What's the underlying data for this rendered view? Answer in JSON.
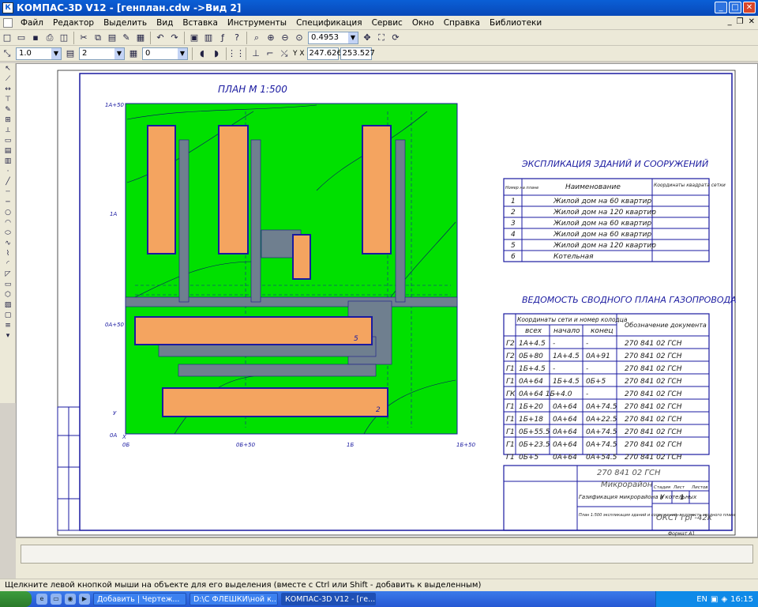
{
  "window": {
    "title": "КОМПАС-3D V12 - [генплан.cdw ->Вид 2]",
    "app_icon": "kompas-icon"
  },
  "menu": [
    "Файл",
    "Редактор",
    "Выделить",
    "Вид",
    "Вставка",
    "Инструменты",
    "Спецификация",
    "Сервис",
    "Окно",
    "Справка",
    "Библиотеки"
  ],
  "toolbar": {
    "zoom": "0.4953"
  },
  "toolbar2": {
    "linetype_scale": "1.0",
    "layer": "2",
    "style": "0",
    "coord_x": "247.626",
    "coord_y": "253.527"
  },
  "drawing": {
    "plan_title": "ПЛАН  М 1:500",
    "grid_labels": {
      "top_left": "1А+50",
      "mid_left": "1А",
      "low_left": "0А+50",
      "bottom_left": "0А",
      "b1": "0Б",
      "b2": "0Б+50",
      "b3": "1Б",
      "b4": "1Б+50",
      "axis_y": "У",
      "axis_x": "Х"
    },
    "explication": {
      "title": "ЭКСПЛИКАЦИЯ ЗДАНИЙ И СООРУЖЕНИЙ",
      "headers": [
        "Номер на плане",
        "Наименование",
        "Координаты квадрата сетки"
      ],
      "rows": [
        {
          "n": "1",
          "name": "Жилой дом на 60 квартир"
        },
        {
          "n": "2",
          "name": "Жилой дом на 120 квартир"
        },
        {
          "n": "3",
          "name": "Жилой дом на 60 квартир"
        },
        {
          "n": "4",
          "name": "Жилой дом на 60 квартир"
        },
        {
          "n": "5",
          "name": "Жилой дом на 120 квартир"
        },
        {
          "n": "6",
          "name": "Котельная"
        }
      ]
    },
    "vedomost": {
      "title": "ВЕДОМОСТЬ СВОДНОГО ПЛАНА ГАЗОПРОВОДА",
      "headers": {
        "coords": "Координаты сети и номер колодца",
        "all": "всех",
        "start": "начало",
        "end": "конец",
        "designation": "Обозначение документа"
      },
      "rows": [
        {
          "g": "Г2",
          "all": "1А+4.5",
          "start": "-",
          "end": "-",
          "doc": "270 841 02 ГСН"
        },
        {
          "g": "Г2",
          "all": "0Б+80",
          "start": "1А+4.5",
          "end": "0А+91",
          "doc": "270 841 02 ГСН"
        },
        {
          "g": "Г1",
          "all": "1Б+4.5",
          "start": "-",
          "end": "-",
          "doc": "270 841 02 ГСН"
        },
        {
          "g": "Г1",
          "all": "0А+64",
          "start": "1Б+4.5",
          "end": "0Б+5",
          "doc": "270 841 02 ГСН"
        },
        {
          "g": "ГК",
          "all": "0А+64 1Б+4.0",
          "start": "-",
          "end": "-",
          "doc": "270 841 02 ГСН"
        },
        {
          "g": "Г1",
          "all": "1Б+20",
          "start": "0А+64",
          "end": "0А+74.5",
          "doc": "270 841 02 ГСН"
        },
        {
          "g": "Г1",
          "all": "1Б+18",
          "start": "0А+64",
          "end": "0А+22.5",
          "doc": "270 841 02 ГСН"
        },
        {
          "g": "Г1",
          "all": "0Б+55.5",
          "start": "0А+64",
          "end": "0А+74.5",
          "doc": "270 841 02 ГСН"
        },
        {
          "g": "Г1",
          "all": "0Б+23.5",
          "start": "0А+64",
          "end": "0А+74.5",
          "doc": "270 841 02 ГСН"
        },
        {
          "g": "Г1",
          "all": "0Б+5",
          "start": "0А+64",
          "end": "0А+54.5",
          "doc": "270 841 02 ГСН"
        }
      ]
    },
    "stamp": {
      "code": "270 841 02 ГСН",
      "name": "Микрорайон",
      "subject": "Газификация микрорайона и котельных",
      "sheet_desc": "План 1:500 экспликация зданий и сооружений, ведомость сводного плана",
      "org": "ОКСТ грГ-42к",
      "stage_label": "Стадия",
      "sheet_label": "Лист",
      "sheets_label": "Листов",
      "stage": "У",
      "sheet": "1",
      "format": "Формат  А1"
    }
  },
  "statusbar": {
    "hint": "Щелкните левой кнопкой мыши на объекте для его выделения (вместе с Ctrl или Shift - добавить к выделенным)"
  },
  "taskbar": {
    "tasks": [
      "Добавить | Чертеж...",
      "D:\\С ФЛЕШКИ\\ной к...",
      "КОМПАС-3D V12 - [ге..."
    ],
    "lang": "EN",
    "clock": "16:15"
  }
}
